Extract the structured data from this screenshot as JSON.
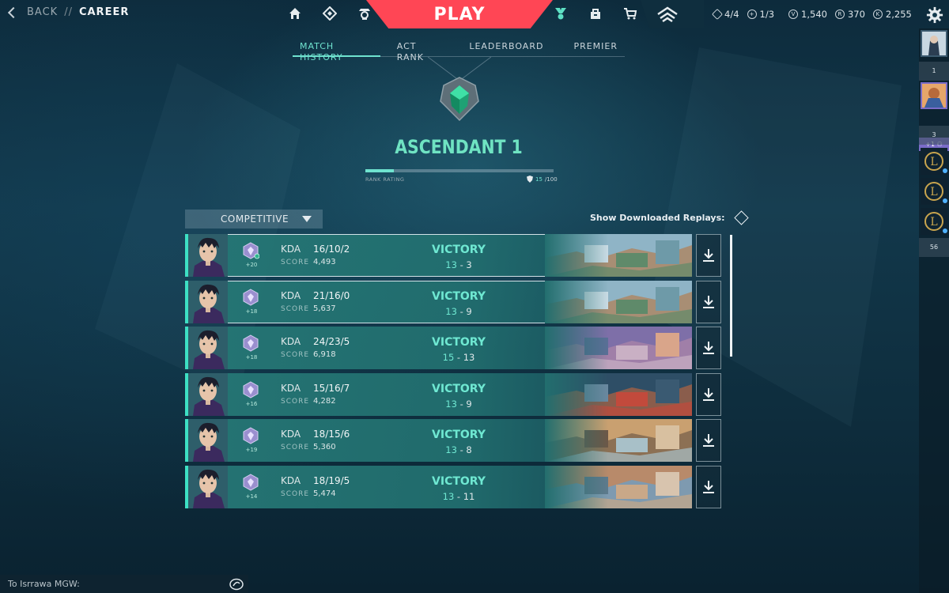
{
  "header": {
    "back_label": "BACK",
    "separator": "//",
    "page_title": "CAREER",
    "play_label": "PLAY",
    "left_icons": [
      "home-icon",
      "agents-icon",
      "collection-icon"
    ],
    "right_icons": [
      "battlepass-icon",
      "store-icon",
      "cart-icon"
    ],
    "party_status": [
      {
        "icon": "diamond-icon",
        "value": "4/4"
      },
      {
        "icon": "plus-circle-icon",
        "value": "1/3"
      }
    ],
    "currencies": [
      {
        "icon": "valorant-points-icon",
        "value": "1,540"
      },
      {
        "icon": "radianite-icon",
        "value": "370"
      },
      {
        "icon": "kingdom-credits-icon",
        "value": "2,255"
      }
    ]
  },
  "tabs": [
    {
      "label": "MATCH HISTORY",
      "active": true
    },
    {
      "label": "ACT RANK",
      "active": false
    },
    {
      "label": "LEADERBOARD",
      "active": false
    },
    {
      "label": "PREMIER",
      "active": false
    }
  ],
  "rank": {
    "name": "ASCENDANT 1",
    "rating_label": "RANK RATING",
    "rating_current": "15",
    "rating_max": "/100",
    "rating_fraction": 0.15,
    "color": "#6fe3c2"
  },
  "filters": {
    "queue": "COMPETITIVE",
    "replays_label": "Show Downloaded Replays:"
  },
  "matches": [
    {
      "kda_label": "KDA",
      "kda": "16/10/2",
      "score_label": "SCORE",
      "score": "4,493",
      "rr": "+20",
      "result": "VICTORY",
      "team": "13",
      "dash": "-",
      "enemy": "3",
      "map": "sunset",
      "outlined": true,
      "rank_badge_extra": true
    },
    {
      "kda_label": "KDA",
      "kda": "21/16/0",
      "score_label": "SCORE",
      "score": "5,637",
      "rr": "+18",
      "result": "VICTORY",
      "team": "13",
      "dash": "-",
      "enemy": "9",
      "map": "sunset",
      "outlined": true,
      "rank_badge_extra": false
    },
    {
      "kda_label": "KDA",
      "kda": "24/23/5",
      "score_label": "SCORE",
      "score": "6,918",
      "rr": "+18",
      "result": "VICTORY",
      "team": "15",
      "dash": "-",
      "enemy": "13",
      "map": "ascent",
      "outlined": false,
      "rank_badge_extra": false
    },
    {
      "kda_label": "KDA",
      "kda": "15/16/7",
      "score_label": "SCORE",
      "score": "4,282",
      "rr": "+16",
      "result": "VICTORY",
      "team": "13",
      "dash": "-",
      "enemy": "9",
      "map": "split",
      "outlined": false,
      "rank_badge_extra": false
    },
    {
      "kda_label": "KDA",
      "kda": "18/15/6",
      "score_label": "SCORE",
      "score": "5,360",
      "rr": "+19",
      "result": "VICTORY",
      "team": "13",
      "dash": "-",
      "enemy": "8",
      "map": "bind",
      "outlined": false,
      "rank_badge_extra": false
    },
    {
      "kda_label": "KDA",
      "kda": "18/19/5",
      "score_label": "SCORE",
      "score": "5,474",
      "rr": "+14",
      "result": "VICTORY",
      "team": "13",
      "dash": "-",
      "enemy": "11",
      "map": "haven",
      "outlined": false,
      "rank_badge_extra": false
    }
  ],
  "social": {
    "party_count": "1",
    "party_extra": "+1",
    "group_count": "3",
    "friends_count": "56"
  },
  "chat": {
    "placeholder": "To Isrrawa MGW:"
  },
  "colors": {
    "accent_teal": "#6fe3cf",
    "play_red": "#ff4655",
    "victory": "#6fe8d2"
  }
}
